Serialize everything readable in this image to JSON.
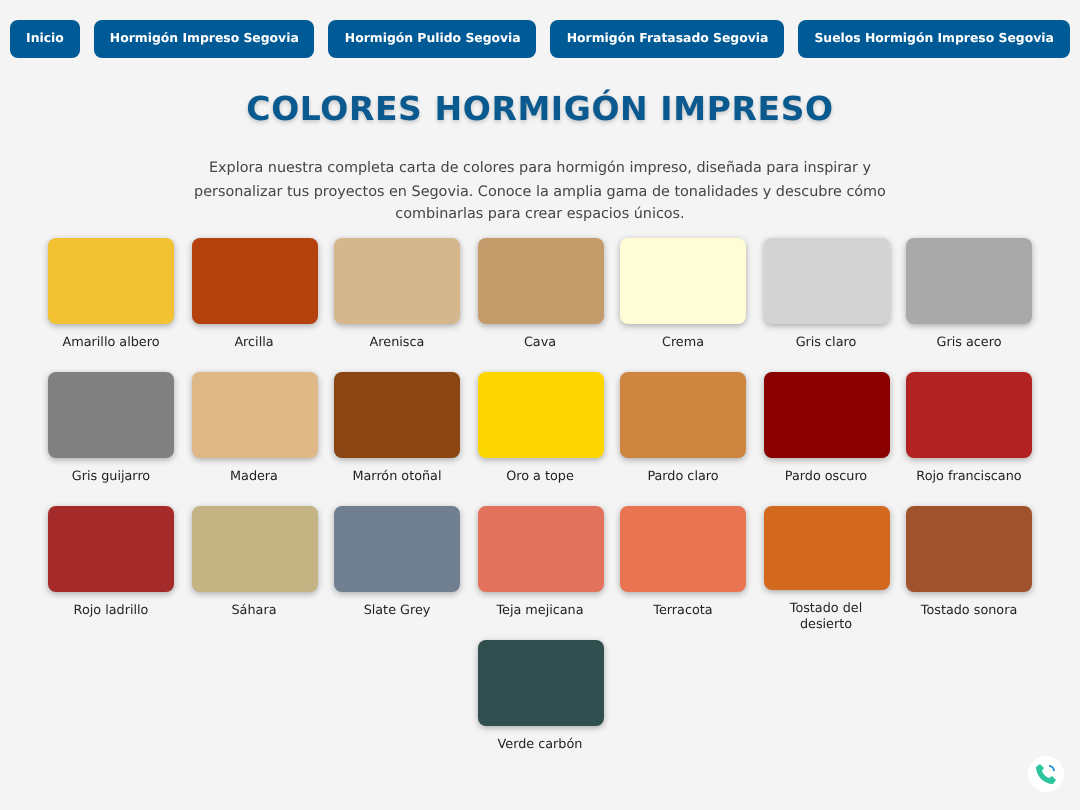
{
  "nav": [
    {
      "label": "Inicio"
    },
    {
      "label": "Hormigón Impreso Segovia"
    },
    {
      "label": "Hormigón Pulido Segovia"
    },
    {
      "label": "Hormigón Fratasado Segovia"
    },
    {
      "label": "Suelos Hormigón Impreso Segovia"
    }
  ],
  "title": "COLORES HORMIGÓN IMPRESO",
  "intro": "Explora nuestra completa carta de colores para hormigón impreso, diseñada para inspirar y personalizar tus proyectos en Segovia. Conoce la amplia gama de tonalidades y descubre cómo combinarlas para crear espacios únicos.",
  "colors": [
    {
      "name": "Amarillo albero",
      "color": "#f2c232"
    },
    {
      "name": "Arcilla",
      "color": "#b5410f"
    },
    {
      "name": "Arenisca",
      "color": "#d5b78e"
    },
    {
      "name": "Cava",
      "color": "#c49c6c"
    },
    {
      "name": "Crema",
      "color": "#fefdd6"
    },
    {
      "name": "Gris claro",
      "color": "#d3d3d3"
    },
    {
      "name": "Gris acero",
      "color": "#a9a9a9"
    },
    {
      "name": "Gris guijarro",
      "color": "#808080"
    },
    {
      "name": "Madera",
      "color": "#deb887"
    },
    {
      "name": "Marrón otoñal",
      "color": "#8b4513"
    },
    {
      "name": "Oro a tope",
      "color": "#ffd700"
    },
    {
      "name": "Pardo claro",
      "color": "#cd853f"
    },
    {
      "name": "Pardo oscuro",
      "color": "#8b0000"
    },
    {
      "name": "Rojo franciscano",
      "color": "#b22222"
    },
    {
      "name": "Rojo ladrillo",
      "color": "#a52a2a"
    },
    {
      "name": "Sáhara",
      "color": "#c4b484"
    },
    {
      "name": "Slate Grey",
      "color": "#708090"
    },
    {
      "name": "Teja mejicana",
      "color": "#e2725b"
    },
    {
      "name": "Terracota",
      "color": "#e97451"
    },
    {
      "name": "Tostado del desierto",
      "color": "#d2691e"
    },
    {
      "name": "Tostado sonora",
      "color": "#a0522d"
    },
    {
      "name": "Verde carbón",
      "color": "#2f4f4f"
    }
  ]
}
